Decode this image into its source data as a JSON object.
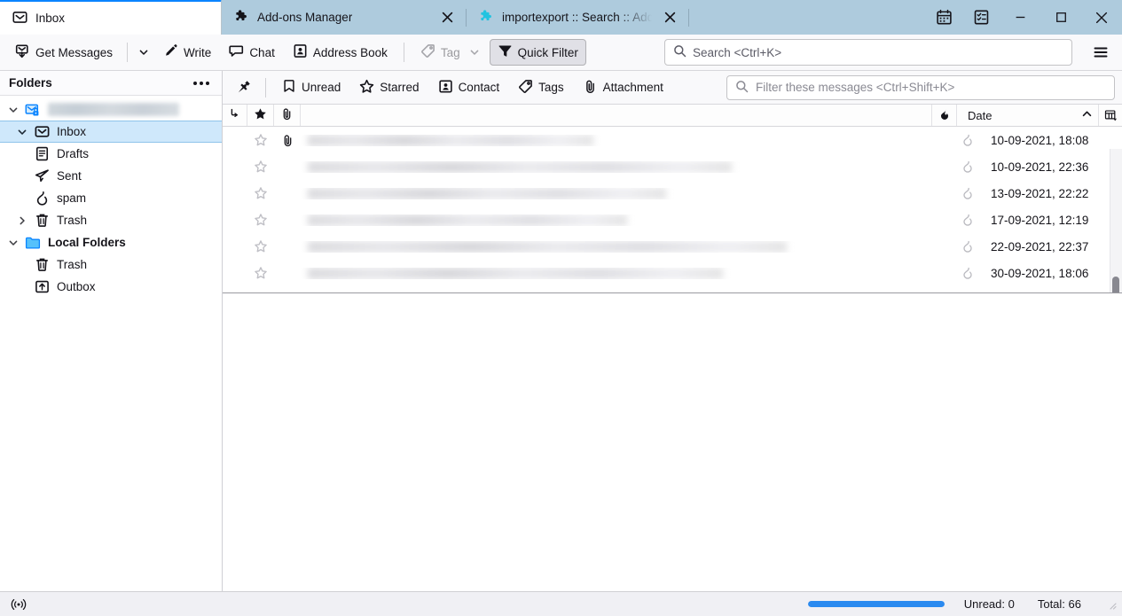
{
  "window": {
    "tabs": [
      {
        "label": "Inbox",
        "icon": "inbox-icon",
        "active": true,
        "closable": false
      },
      {
        "label": "Add-ons Manager",
        "icon": "puzzle-piece-icon",
        "active": false,
        "closable": true
      },
      {
        "label": "importexport :: Search :: Add",
        "icon": "puzzle-piece-teal-icon",
        "active": false,
        "closable": true
      }
    ],
    "titlebar_buttons": [
      {
        "name": "calendar-icon",
        "label": "Calendar"
      },
      {
        "name": "tasks-icon",
        "label": "Tasks"
      }
    ],
    "window_controls": [
      {
        "name": "minimize-button",
        "glyph": "minimize"
      },
      {
        "name": "maximize-button",
        "glyph": "maximize"
      },
      {
        "name": "close-button",
        "glyph": "close"
      }
    ],
    "accent_color": "#0a84ff",
    "tabbar_color": "#aecbdd"
  },
  "toolbar": {
    "get_messages_label": "Get Messages",
    "write_label": "Write",
    "chat_label": "Chat",
    "address_book_label": "Address Book",
    "tag_label": "Tag",
    "tag_disabled": true,
    "quick_filter_label": "Quick Filter",
    "quick_filter_pressed": true,
    "search": {
      "placeholder": "Search <Ctrl+K>",
      "value": ""
    },
    "menu_label": "Application Menu"
  },
  "folder_pane": {
    "header_title": "Folders",
    "more_label": "More options",
    "items": [
      {
        "label": "",
        "redacted": true,
        "icon": "secure-mail-account-icon",
        "depth": 0,
        "twisty": "down",
        "selected": false,
        "bold": false
      },
      {
        "label": "Inbox",
        "redacted": false,
        "icon": "inbox-icon",
        "depth": 1,
        "twisty": "down",
        "selected": true,
        "bold": false
      },
      {
        "label": "Drafts",
        "redacted": false,
        "icon": "drafts-icon",
        "depth": 2,
        "twisty": "none",
        "selected": false,
        "bold": false
      },
      {
        "label": "Sent",
        "redacted": false,
        "icon": "sent-icon",
        "depth": 2,
        "twisty": "none",
        "selected": false,
        "bold": false
      },
      {
        "label": "spam",
        "redacted": false,
        "icon": "spam-flame-icon",
        "depth": 2,
        "twisty": "none",
        "selected": false,
        "bold": false
      },
      {
        "label": "Trash",
        "redacted": false,
        "icon": "trash-icon",
        "depth": 2,
        "twisty": "right",
        "selected": false,
        "bold": false
      },
      {
        "label": "Local Folders",
        "redacted": false,
        "icon": "folder-icon",
        "depth": 0,
        "twisty": "down",
        "selected": false,
        "bold": true
      },
      {
        "label": "Trash",
        "redacted": false,
        "icon": "trash-icon",
        "depth": 1,
        "twisty": "none",
        "selected": false,
        "bold": false
      },
      {
        "label": "Outbox",
        "redacted": false,
        "icon": "outbox-icon",
        "depth": 1,
        "twisty": "none",
        "selected": false,
        "bold": false
      }
    ]
  },
  "quick_filter_bar": {
    "pin_label": "Pin filter",
    "buttons": [
      {
        "label": "Unread",
        "icon": "bookmark-icon",
        "active": false
      },
      {
        "label": "Starred",
        "icon": "star-icon",
        "active": false
      },
      {
        "label": "Contact",
        "icon": "contact-card-icon",
        "active": false
      },
      {
        "label": "Tags",
        "icon": "tag-icon",
        "active": false
      },
      {
        "label": "Attachment",
        "icon": "paperclip-icon",
        "active": false
      }
    ],
    "filter_input": {
      "placeholder": "Filter these messages <Ctrl+Shift+K>",
      "value": ""
    }
  },
  "thread_pane": {
    "columns": [
      {
        "key": "thread",
        "label": "",
        "icon": "thread-icon"
      },
      {
        "key": "star",
        "label": "",
        "icon": "star-filled-icon"
      },
      {
        "key": "attachment",
        "label": "",
        "icon": "paperclip-icon"
      },
      {
        "key": "subject",
        "label": "",
        "icon": ""
      },
      {
        "key": "unread",
        "label": "",
        "icon": "flame-icon"
      },
      {
        "key": "date",
        "label": "Date",
        "icon": "",
        "sort": "ascending"
      }
    ],
    "column_picker_label": "Select columns to display",
    "rows": [
      {
        "starred": false,
        "attachment": true,
        "subject_redacted": true,
        "unread_icon": "flame-icon",
        "date": "10-09-2021, 18:08"
      },
      {
        "starred": false,
        "attachment": false,
        "subject_redacted": true,
        "unread_icon": "flame-icon",
        "date": "10-09-2021, 22:36"
      },
      {
        "starred": false,
        "attachment": false,
        "subject_redacted": true,
        "unread_icon": "flame-icon",
        "date": "13-09-2021, 22:22"
      },
      {
        "starred": false,
        "attachment": false,
        "subject_redacted": true,
        "unread_icon": "flame-icon",
        "date": "17-09-2021, 12:19"
      },
      {
        "starred": false,
        "attachment": false,
        "subject_redacted": true,
        "unread_icon": "flame-icon",
        "date": "22-09-2021, 22:37"
      },
      {
        "starred": false,
        "attachment": false,
        "subject_redacted": true,
        "unread_icon": "flame-icon",
        "date": "30-09-2021, 18:06"
      }
    ]
  },
  "status_bar": {
    "network_icon_label": "Network activity",
    "progress_percent": 100,
    "progress_color": "#2a8af0",
    "unread_label": "Unread: 0",
    "total_label": "Total: 66"
  }
}
